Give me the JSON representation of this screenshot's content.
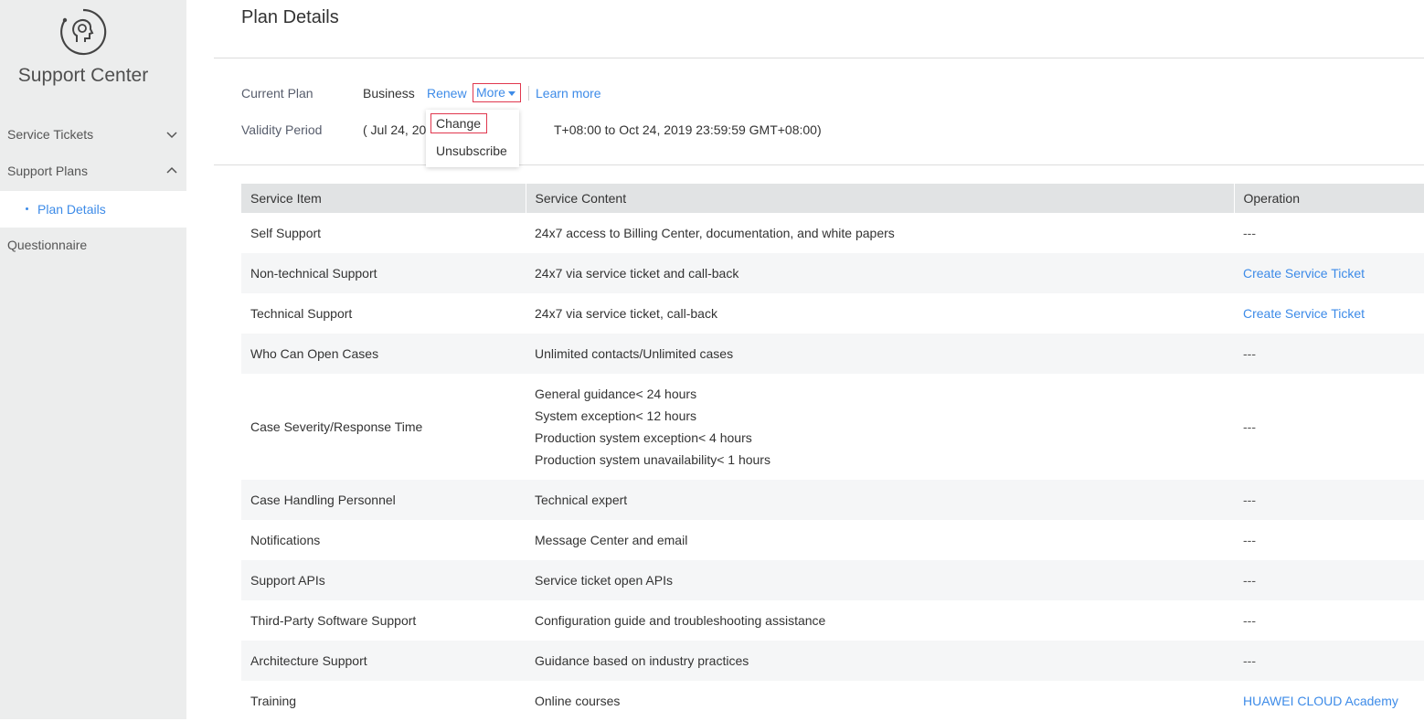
{
  "app": {
    "title": "Support Center",
    "logo_icon": "headset-person-icon"
  },
  "sidebar": {
    "items": [
      {
        "label": "Service Tickets",
        "expanded": false
      },
      {
        "label": "Support Plans",
        "expanded": true
      },
      {
        "label": "Questionnaire"
      }
    ],
    "sub_item": {
      "label": "Plan Details",
      "active": true
    }
  },
  "page": {
    "title": "Plan Details"
  },
  "plan": {
    "current_plan_label": "Current Plan",
    "current_plan_value": "Business",
    "renew": "Renew",
    "more": "More",
    "learn_more": "Learn more",
    "validity_label": "Validity Period",
    "validity_start": "( Jul 24, 20",
    "validity_end": "T+08:00 to Oct 24, 2019 23:59:59 GMT+08:00)"
  },
  "dropdown": {
    "change": "Change",
    "unsubscribe": "Unsubscribe"
  },
  "table": {
    "headers": [
      "Service Item",
      "Service Content",
      "Operation"
    ],
    "rows": [
      {
        "item": "Self Support",
        "content": "24x7 access to Billing Center, documentation, and white papers",
        "op": "---"
      },
      {
        "item": "Non-technical Support",
        "content": "24x7 via service ticket and call-back",
        "op": "Create Service Ticket"
      },
      {
        "item": "Technical Support",
        "content": "24x7 via service ticket, call-back",
        "op": "Create Service Ticket"
      },
      {
        "item": "Who Can Open Cases",
        "content": "Unlimited contacts/Unlimited cases",
        "op": "---"
      },
      {
        "item": "Case Severity/Response Time",
        "content_lines": [
          "General guidance< 24 hours",
          "System exception< 12 hours",
          "Production system exception< 4 hours",
          "Production system unavailability< 1 hours"
        ],
        "op": "---"
      },
      {
        "item": "Case Handling Personnel",
        "content": "Technical expert",
        "op": "---"
      },
      {
        "item": "Notifications",
        "content": "Message Center and email",
        "op": "---"
      },
      {
        "item": "Support APIs",
        "content": "Service ticket open APIs",
        "op": "---"
      },
      {
        "item": "Third-Party Software Support",
        "content": "Configuration guide and troubleshooting assistance",
        "op": "---"
      },
      {
        "item": "Architecture Support",
        "content": "Guidance based on industry practices",
        "op": "---"
      },
      {
        "item": "Training",
        "content": "Online courses",
        "op": "HUAWEI CLOUD Academy"
      }
    ]
  }
}
